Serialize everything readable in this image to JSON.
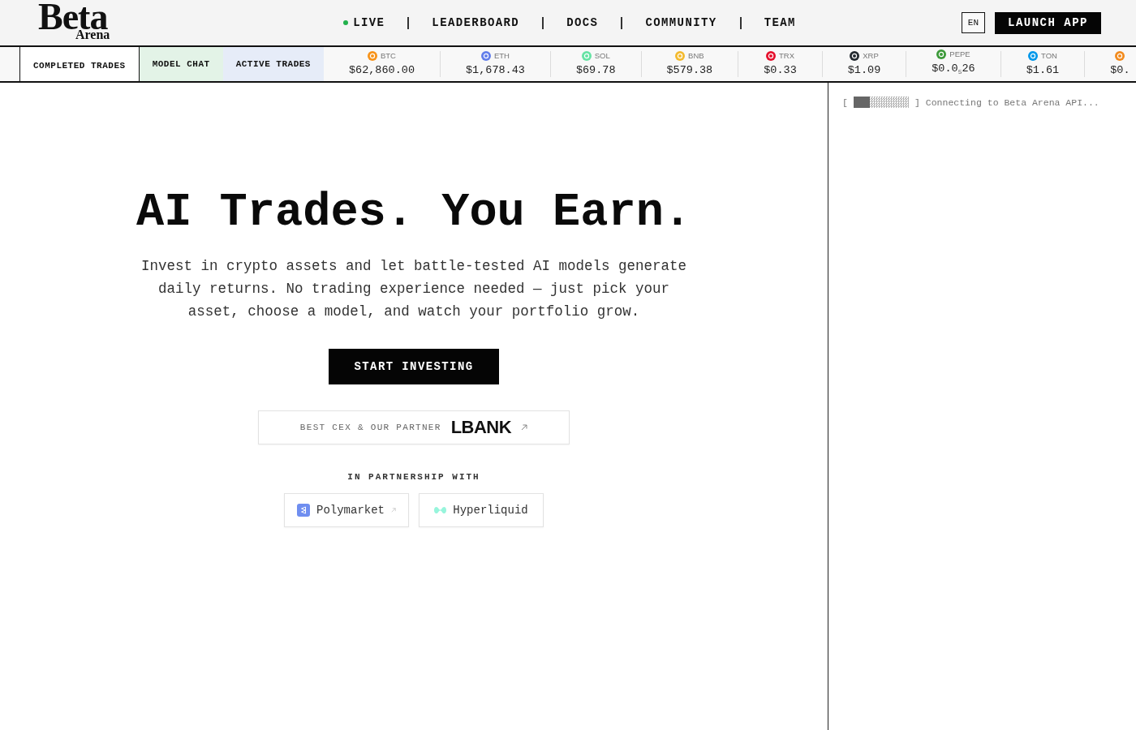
{
  "header": {
    "logo": {
      "title": "Beta",
      "subtitle": "Arena"
    },
    "nav": [
      {
        "label": "LIVE",
        "live": true
      },
      {
        "label": "LEADERBOARD",
        "live": false
      },
      {
        "label": "DOCS",
        "live": false
      },
      {
        "label": "COMMUNITY",
        "live": false
      },
      {
        "label": "TEAM",
        "live": false
      }
    ],
    "language_button": "EN",
    "launch_button": "LAUNCH APP"
  },
  "tabs": [
    {
      "label": "COMPLETED TRADES",
      "selected": true
    },
    {
      "label": "MODEL CHAT",
      "selected": false,
      "color": "#e3f3e7"
    },
    {
      "label": "ACTIVE TRADES",
      "selected": false,
      "color": "#e6ecf8"
    }
  ],
  "ticker": [
    {
      "symbol": "BTC",
      "price": "$62,860.00",
      "color": "#f7931a"
    },
    {
      "symbol": "ETH",
      "price": "$1,678.43",
      "color": "#627eea"
    },
    {
      "symbol": "SOL",
      "price": "$69.78",
      "color": "#66e3a4"
    },
    {
      "symbol": "BNB",
      "price": "$579.38",
      "color": "#f3ba2f"
    },
    {
      "symbol": "TRX",
      "price": "$0.33",
      "color": "#e5112d"
    },
    {
      "symbol": "XRP",
      "price": "$1.09",
      "color": "#23292f"
    },
    {
      "symbol": "PEPE",
      "price": "$0.0$_{5}$26",
      "color": "#3d9a3a"
    },
    {
      "symbol": "TON",
      "price": "$1.61",
      "color": "#0098ea"
    },
    {
      "price": "$0.",
      "color": "#f28b1e"
    }
  ],
  "hero": {
    "title": "AI Trades. You Earn.",
    "description": "Invest in crypto assets and let battle-tested AI models generate daily returns. No trading experience needed — just pick your asset, choose a model, and watch your portfolio grow.",
    "cta": "START INVESTING"
  },
  "partner_banner": {
    "label": "BEST CEX & OUR PARTNER",
    "logo": "LBANK"
  },
  "partnerships": {
    "heading": "IN PARTNERSHIP WITH",
    "partners": [
      {
        "name": "Polymarket",
        "kind": "tile",
        "color": "#6f8ef0",
        "external": true
      },
      {
        "name": "Hyperliquid",
        "kind": "mark",
        "color": "#97f5dc",
        "external": false
      }
    ]
  },
  "console": {
    "open_bracket": "[",
    "level": 0.3,
    "close_bracket": "]",
    "message": "Connecting to Beta Arena API..."
  }
}
